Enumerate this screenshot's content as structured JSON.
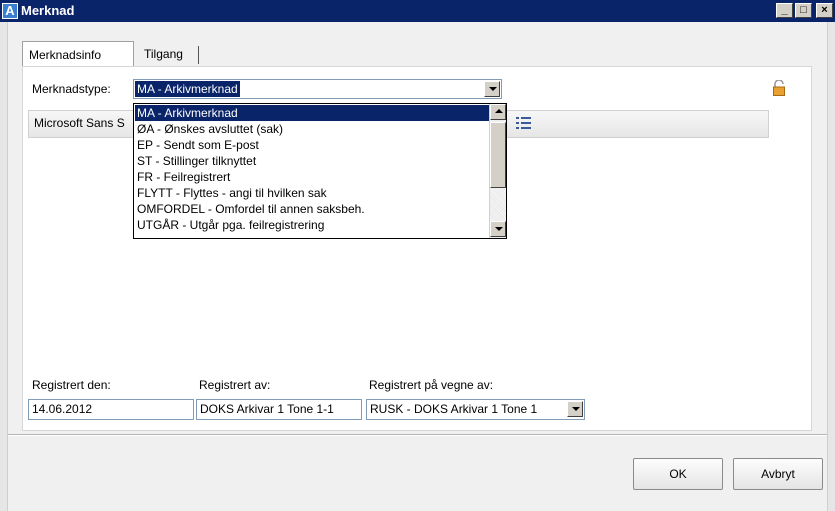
{
  "window": {
    "title": "Merknad",
    "app_icon_letter": "A",
    "minimize": "_",
    "maximize": "□",
    "close": "×"
  },
  "tabs": [
    {
      "label": "Merknadsinfo",
      "active": true
    },
    {
      "label": "Tilgang",
      "active": false
    }
  ],
  "merknadstype": {
    "label": "Merknadstype:",
    "value": "MA - Arkivmerknad",
    "options": [
      "MA - Arkivmerknad",
      "ØA - Ønskes avsluttet (sak)",
      "EP - Sendt som E-post",
      "ST - Stillinger tilknyttet",
      "FR - Feilregistrert",
      "FLYTT - Flyttes - angi til hvilken sak",
      "OMFORDEL - Omfordel til annen saksbeh.",
      "UTGÅR - Utgår pga. feilregistrering"
    ],
    "selected_index": 0
  },
  "editor": {
    "font": "Microsoft Sans S"
  },
  "registrert_den": {
    "label": "Registrert den:",
    "value": "14.06.2012"
  },
  "registrert_av": {
    "label": "Registrert av:",
    "value": "DOKS Arkivar 1 Tone 1-1"
  },
  "registrert_paa_vegne_av": {
    "label": "Registrert på vegne av:",
    "value": "RUSK - DOKS Arkivar 1 Tone 1"
  },
  "buttons": {
    "ok": "OK",
    "cancel": "Avbryt"
  },
  "colors": {
    "titlebar": "#0a246a",
    "selection": "#0a246a",
    "lock": "#e8a030"
  },
  "icons": {
    "lock": "lock-icon",
    "list": "list-icon"
  }
}
